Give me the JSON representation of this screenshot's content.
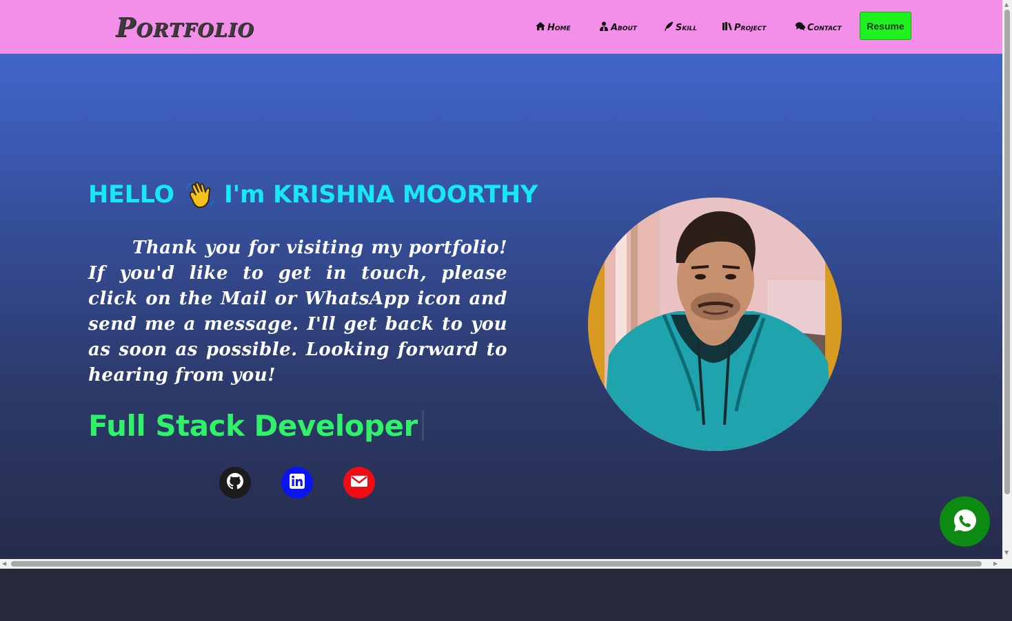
{
  "navbar": {
    "logo": "Portfolio",
    "items": [
      {
        "label": "Home",
        "icon": "home-icon"
      },
      {
        "label": "About",
        "icon": "user-tie-icon"
      },
      {
        "label": "Skill",
        "icon": "feather-icon"
      },
      {
        "label": "Project",
        "icon": "books-icon"
      },
      {
        "label": "Contact",
        "icon": "comments-icon"
      }
    ],
    "resume_label": "Resume"
  },
  "hero": {
    "greeting_prefix": "HELLO",
    "greeting_name": "I'm KRISHNA MOORTHY",
    "intro": "Thank you for visiting my portfolio! If you'd like to get in touch, please click on the Mail or WhatsApp icon and send me a message. I'll get back to you as soon as possible. Looking forward to hearing from you!",
    "role": "Full Stack Developer"
  },
  "social": [
    {
      "name": "github",
      "icon": "github-icon",
      "color": "#1c1c1c"
    },
    {
      "name": "linkedin",
      "icon": "linkedin-icon",
      "color": "#0a14ef"
    },
    {
      "name": "mail",
      "icon": "mail-icon",
      "color": "#ef0d14"
    }
  ],
  "colors": {
    "navbar_bg": "#f38ee9",
    "greeting": "#18e7f5",
    "role": "#2ff268",
    "resume_bg": "#1ff21f",
    "whatsapp_bg": "#0c8a12"
  }
}
